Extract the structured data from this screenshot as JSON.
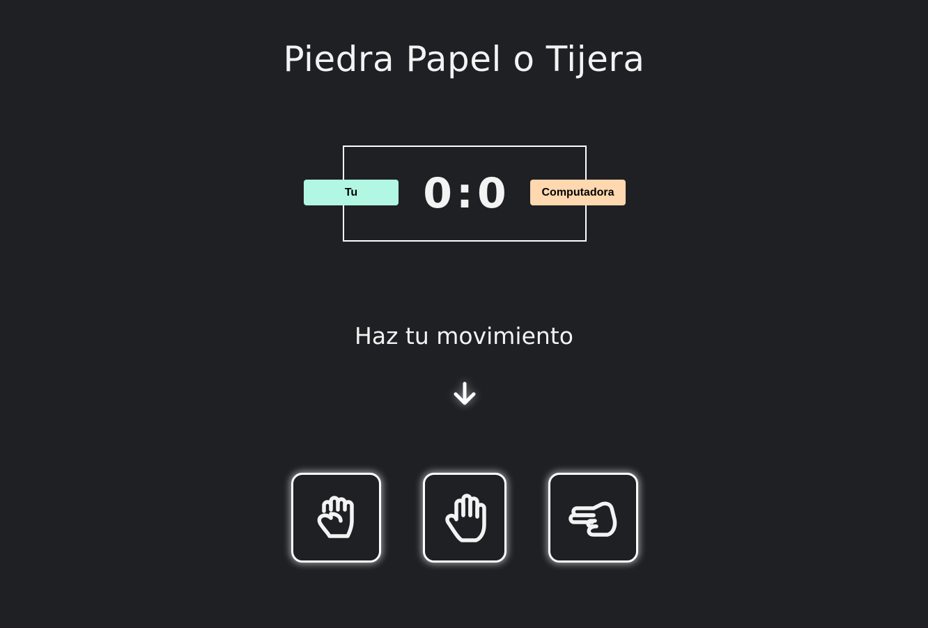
{
  "title": "Piedra Papel o Tijera",
  "scoreboard": {
    "user_label": "Tu",
    "computer_label": "Computadora",
    "user_score": "0",
    "separator": ":",
    "computer_score": "0"
  },
  "prompt": "Haz tu movimiento",
  "colors": {
    "background": "#1f2024",
    "user_badge": "#b2f7e1",
    "computer_badge": "#ffd8b0",
    "text": "#f3f3f3"
  },
  "choices": [
    {
      "id": "rock",
      "icon": "fist-icon"
    },
    {
      "id": "paper",
      "icon": "open-hand-icon"
    },
    {
      "id": "scissors",
      "icon": "scissors-hand-icon"
    }
  ]
}
